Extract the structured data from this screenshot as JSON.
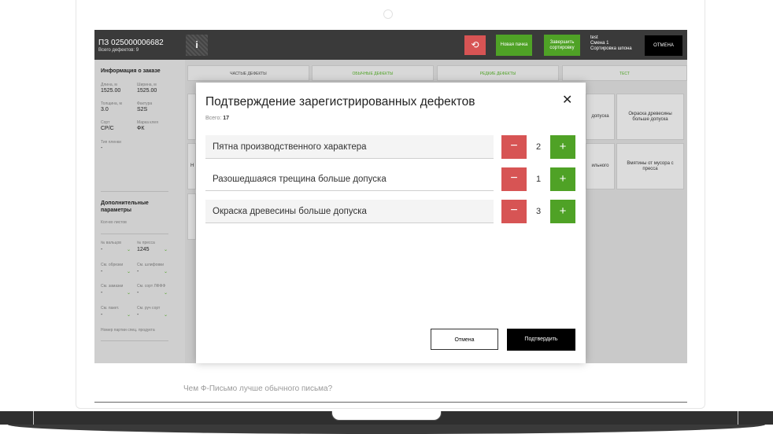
{
  "header": {
    "order_title": "ПЗ 025000006682",
    "defects_total_label": "Всего дефектов: 9",
    "info_label": "i",
    "undo_icon": "⟲",
    "new_pack": "Новая пачка",
    "finish_sort": "Завершить сортировку",
    "user": "test",
    "shift": "Смена 1",
    "mode": "Сортировка шпона",
    "cancel": "ОТМЕНА"
  },
  "sidebar": {
    "order_info_title": "Информация о заказе",
    "length_label": "Длина, м",
    "length_value": "1525.00",
    "width_label": "Ширина, м",
    "width_value": "1525.00",
    "thickness_label": "Толщина, м",
    "thickness_value": "3.0",
    "texture_label": "Фактура",
    "texture_value": "S2S",
    "grade_label": "Сорт",
    "grade_value": "CP/C",
    "glue_label": "Марка клея",
    "glue_value": "ФК",
    "film_label": "Тип пленки",
    "film_value": "-",
    "extra_title": "Дополнительные параметры",
    "sheets_label": "Кол-во листов",
    "shaft_label": "№ вальцов",
    "shaft_value": "-",
    "press_label": "№ пресса",
    "press_value": "1245",
    "trim_label": "См. обрезки",
    "trim_value": "-",
    "grind_label": "См. шлифовки",
    "grind_value": "-",
    "putty_label": "См. замазки",
    "putty_value": "-",
    "sort_lfff_label": "См. сорт ЛФФФ",
    "sort_lfff_value": "-",
    "impreg_label": "См. пакет.",
    "impreg_value": "-",
    "manual_label": "См. руч сорт",
    "manual_value": "-",
    "batch_label": "Номер партии спец. продукта"
  },
  "tabs": [
    "ЧАСТЫЕ ДЕФЕКТЫ",
    "ОБЫЧНЫЕ ДЕФЕКТЫ",
    "РЕДКИЕ ДЕФЕКТЫ",
    "ТЕСТ"
  ],
  "bg_cards": {
    "card1": "допуска",
    "card2": "Окраска древесины больше допуска",
    "card3": "ильного",
    "card4": "Вмятины от мусора с пресса",
    "card5": "Н"
  },
  "modal": {
    "title": "Подтверждение зарегистрированных дефектов",
    "close": "✕",
    "total_label": "Всего:",
    "total_value": "17",
    "rows": [
      {
        "label": "Пятна производственного характера",
        "count": "2"
      },
      {
        "label": "Разошедшаяся трещина больше допуска",
        "count": "1"
      },
      {
        "label": "Окраска древесины больше допуска",
        "count": "3"
      }
    ],
    "minus": "−",
    "plus": "+",
    "cancel": "Отмена",
    "confirm": "Подтвердить"
  },
  "caption": "Чем Ф-Письмо лучше обычного письма?",
  "colors": {
    "accent_green": "#4fa226",
    "accent_red": "#d75454",
    "topbar": "#3a3a3a"
  }
}
